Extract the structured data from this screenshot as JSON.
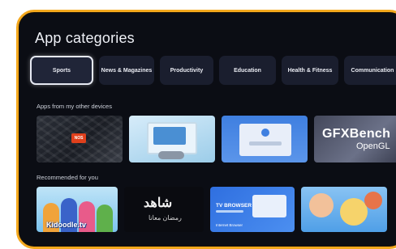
{
  "page": {
    "title": "App categories"
  },
  "categories": [
    {
      "label": "Sports",
      "selected": true
    },
    {
      "label": "News & Magazines",
      "selected": false
    },
    {
      "label": "Productivity",
      "selected": false
    },
    {
      "label": "Education",
      "selected": false
    },
    {
      "label": "Health & Fitness",
      "selected": false
    },
    {
      "label": "Communication",
      "selected": false
    }
  ],
  "sections": {
    "other_devices": "Apps from my other devices",
    "recommended": "Recommended for you"
  },
  "other_devices_cards": {
    "news_badge": "NOS",
    "gfx_line1": "GFXBench",
    "gfx_line2": "OpenGL"
  },
  "recommended_cards": {
    "kids_caption": "Kidoodle.tv",
    "shahid_logo": "شاهد",
    "shahid_sub": "رمضان معانا",
    "tvbrowser_title": "TV BROWSER",
    "tvbrowser_footer": "Internet Browser"
  },
  "colors": {
    "tv_border": "#f4a81d",
    "screen_bg": "#0b0d14",
    "chip_bg": "#1a1e2e"
  }
}
